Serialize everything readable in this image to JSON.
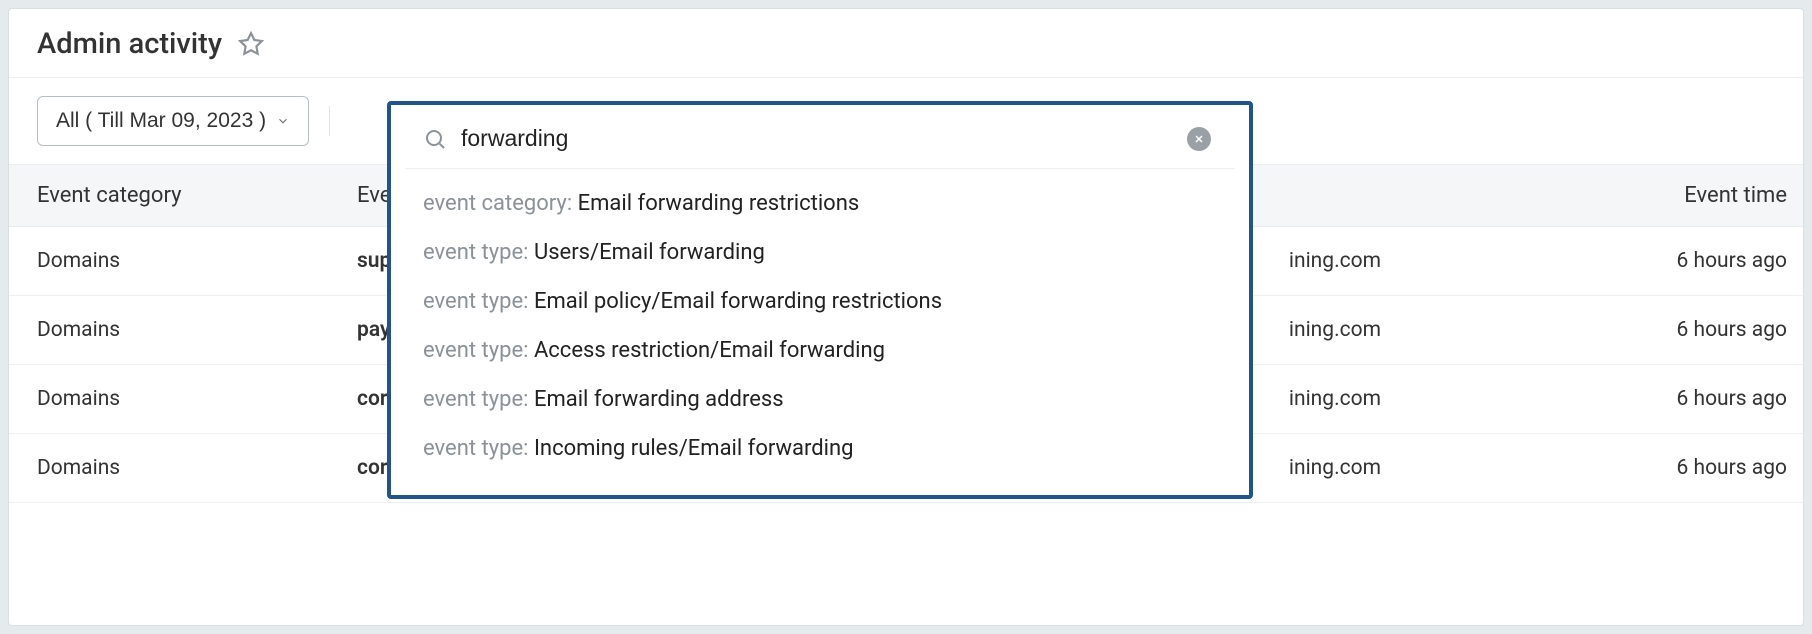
{
  "header": {
    "title": "Admin activity"
  },
  "toolbar": {
    "filter_label": "All ( Till Mar 09, 2023 )"
  },
  "search": {
    "value": "forwarding",
    "suggestions": [
      {
        "prefix": "event category:",
        "text": "Email forwarding restrictions"
      },
      {
        "prefix": "event type:",
        "text": "Users/Email forwarding"
      },
      {
        "prefix": "event type:",
        "text": "Email policy/Email forwarding restrictions"
      },
      {
        "prefix": "event type:",
        "text": "Access restriction/Email forwarding"
      },
      {
        "prefix": "event type:",
        "text": "Email forwarding address"
      },
      {
        "prefix": "event type:",
        "text": "Incoming rules/Email forwarding"
      }
    ]
  },
  "table": {
    "headers": {
      "col1": "Event category",
      "col2": "Eve",
      "col3": "",
      "col4": "Event time"
    },
    "rows": [
      {
        "category": "Domains",
        "event": "sup",
        "actor": "ining.com",
        "time": "6 hours ago"
      },
      {
        "category": "Domains",
        "event": "pay",
        "actor": "ining.com",
        "time": "6 hours ago"
      },
      {
        "category": "Domains",
        "event": "cor",
        "actor": "ining.com",
        "time": "6 hours ago"
      },
      {
        "category": "Domains",
        "event": "cor",
        "actor": "ining.com",
        "time": "6 hours ago"
      }
    ]
  }
}
